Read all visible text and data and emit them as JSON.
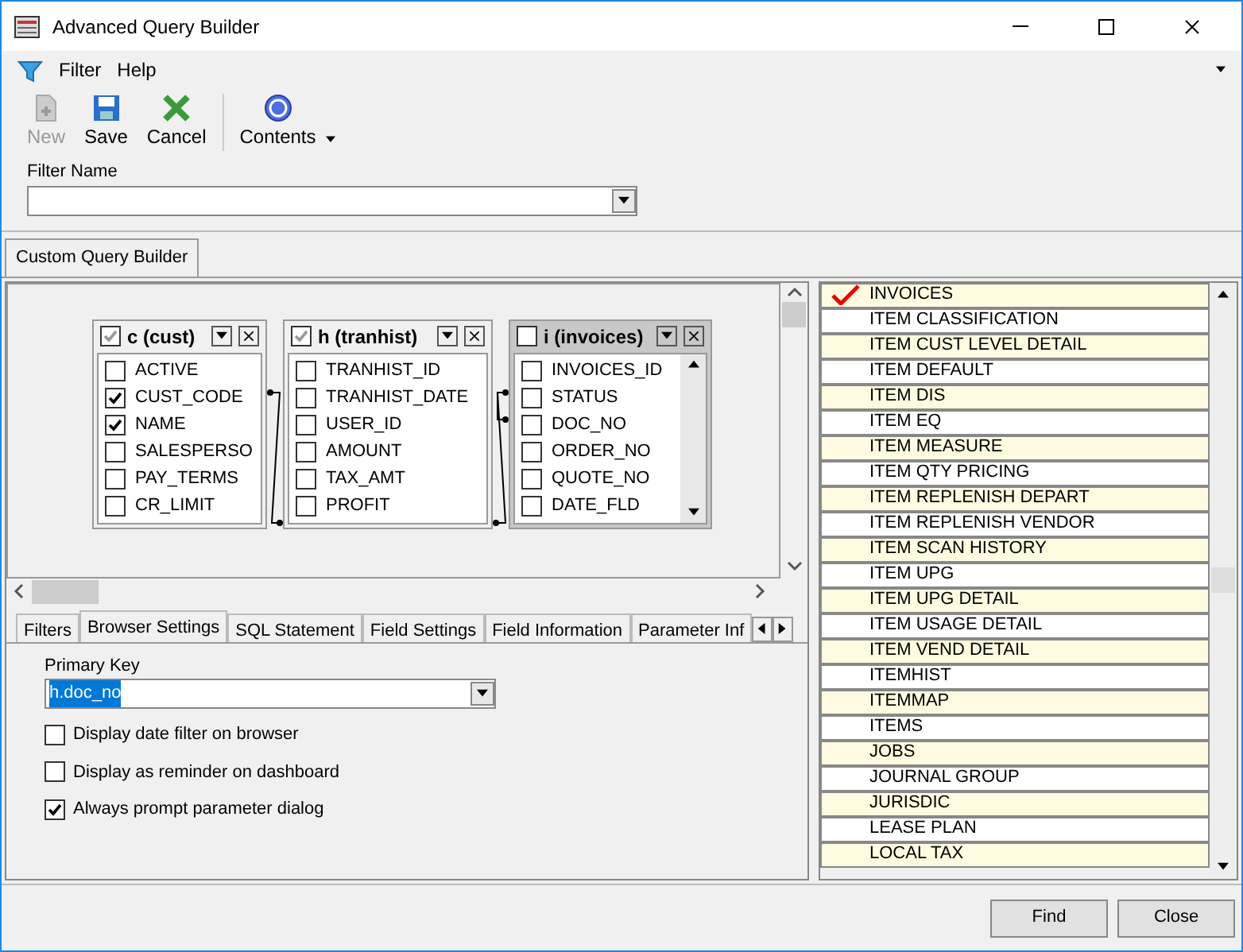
{
  "window": {
    "title": "Advanced Query Builder"
  },
  "menu": [
    {
      "label": "Filter"
    },
    {
      "label": "Help"
    }
  ],
  "toolbar": [
    {
      "label": "New",
      "kind": "new",
      "disabled": true
    },
    {
      "label": "Save",
      "kind": "save",
      "disabled": false
    },
    {
      "label": "Cancel",
      "kind": "cancel",
      "disabled": false
    },
    {
      "label": "Contents",
      "kind": "help",
      "disabled": false
    }
  ],
  "filter_name": {
    "label": "Filter Name"
  },
  "main_tabs": [
    {
      "label": "Custom Query Builder",
      "selected": true
    }
  ],
  "diagram": {
    "tables": [
      {
        "title": "c (cust)",
        "checked": true,
        "selected": false,
        "scrollable": false,
        "fields": [
          {
            "name": "ACTIVE",
            "checked": false
          },
          {
            "name": "CUST_CODE",
            "checked": true
          },
          {
            "name": "NAME",
            "checked": true
          },
          {
            "name": "SALESPERSO",
            "checked": false
          },
          {
            "name": "PAY_TERMS",
            "checked": false
          },
          {
            "name": "CR_LIMIT",
            "checked": false
          }
        ]
      },
      {
        "title": "h (tranhist)",
        "checked": true,
        "selected": false,
        "scrollable": false,
        "fields": [
          {
            "name": "TRANHIST_ID",
            "checked": false
          },
          {
            "name": "TRANHIST_DATE",
            "checked": false
          },
          {
            "name": "USER_ID",
            "checked": false
          },
          {
            "name": "AMOUNT",
            "checked": false
          },
          {
            "name": "TAX_AMT",
            "checked": false
          },
          {
            "name": "PROFIT",
            "checked": false
          }
        ]
      },
      {
        "title": "i (invoices)",
        "checked": false,
        "selected": true,
        "scrollable": true,
        "fields": [
          {
            "name": "INVOICES_ID",
            "checked": false
          },
          {
            "name": "STATUS",
            "checked": false
          },
          {
            "name": "DOC_NO",
            "checked": false
          },
          {
            "name": "ORDER_NO",
            "checked": false
          },
          {
            "name": "QUOTE_NO",
            "checked": false
          },
          {
            "name": "DATE_FLD",
            "checked": false
          }
        ]
      }
    ]
  },
  "bottom_tabs": [
    {
      "label": "Filters",
      "selected": false
    },
    {
      "label": "Browser Settings",
      "selected": true
    },
    {
      "label": "SQL Statement",
      "selected": false
    },
    {
      "label": "Field Settings",
      "selected": false
    },
    {
      "label": "Field Information",
      "selected": false
    },
    {
      "label": "Parameter Inf",
      "selected": false
    }
  ],
  "browser_settings": {
    "primary_key_label": "Primary Key",
    "primary_key_value": "h.doc_no",
    "options": [
      {
        "label": "Display date filter on browser",
        "checked": false
      },
      {
        "label": "Display as reminder on dashboard",
        "checked": false
      },
      {
        "label": "Always prompt parameter dialog",
        "checked": true
      }
    ]
  },
  "table_list": [
    {
      "name": "INVOICES",
      "checked": true
    },
    {
      "name": "ITEM CLASSIFICATION",
      "checked": false
    },
    {
      "name": "ITEM CUST LEVEL DETAIL",
      "checked": false
    },
    {
      "name": "ITEM DEFAULT",
      "checked": false
    },
    {
      "name": "ITEM DIS",
      "checked": false
    },
    {
      "name": "ITEM EQ",
      "checked": false
    },
    {
      "name": "ITEM MEASURE",
      "checked": false
    },
    {
      "name": "ITEM QTY PRICING",
      "checked": false
    },
    {
      "name": "ITEM REPLENISH DEPART",
      "checked": false
    },
    {
      "name": "ITEM REPLENISH VENDOR",
      "checked": false
    },
    {
      "name": "ITEM SCAN HISTORY",
      "checked": false
    },
    {
      "name": "ITEM UPG",
      "checked": false
    },
    {
      "name": "ITEM UPG DETAIL",
      "checked": false
    },
    {
      "name": "ITEM USAGE DETAIL",
      "checked": false
    },
    {
      "name": "ITEM VEND DETAIL",
      "checked": false
    },
    {
      "name": "ITEMHIST",
      "checked": false
    },
    {
      "name": "ITEMMAP",
      "checked": false
    },
    {
      "name": "ITEMS",
      "checked": false
    },
    {
      "name": "JOBS",
      "checked": false
    },
    {
      "name": "JOURNAL GROUP",
      "checked": false
    },
    {
      "name": "JURISDIC",
      "checked": false
    },
    {
      "name": "LEASE PLAN",
      "checked": false
    },
    {
      "name": "LOCAL TAX",
      "checked": false
    }
  ],
  "buttons": [
    {
      "label": "Find"
    },
    {
      "label": "Close"
    }
  ]
}
